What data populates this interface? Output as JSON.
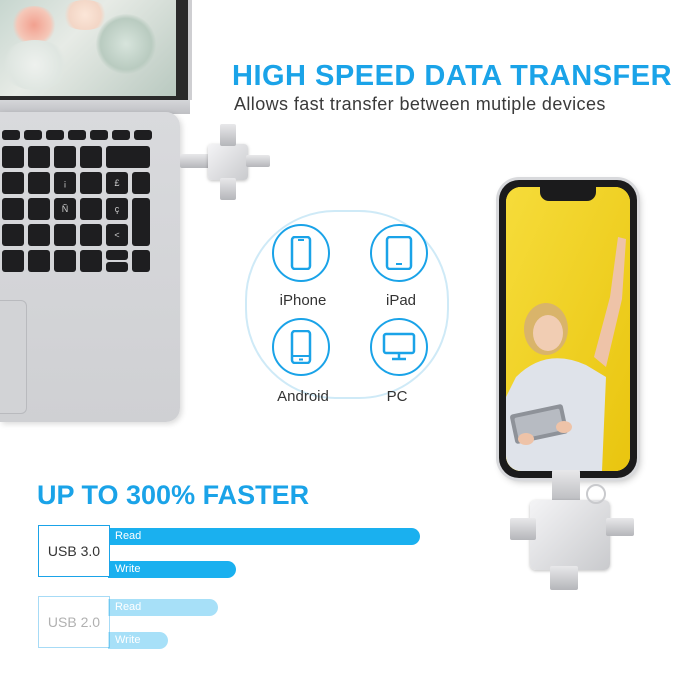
{
  "headline": {
    "title": "HIGH SPEED DATA TRANSFER",
    "subtitle": "Allows fast transfer between mutiple devices"
  },
  "devices": [
    {
      "label": "iPhone",
      "icon": "phone-icon"
    },
    {
      "label": "iPad",
      "icon": "tablet-icon"
    },
    {
      "label": "Android",
      "icon": "android-phone-icon"
    },
    {
      "label": "PC",
      "icon": "monitor-icon"
    }
  ],
  "speed": {
    "title": "UP TO 300% FASTER",
    "usb3": {
      "label": "USB 3.0",
      "read": "Read",
      "write": "Write"
    },
    "usb2": {
      "label": "USB 2.0",
      "read": "Read",
      "write": "Write"
    }
  },
  "keyboard_keys": [
    "¡",
    "£",
    "€",
    "ç",
    "Ñ",
    "<"
  ],
  "colors": {
    "accent": "#1aa3e8",
    "phone_screen": "#f2d21a"
  }
}
